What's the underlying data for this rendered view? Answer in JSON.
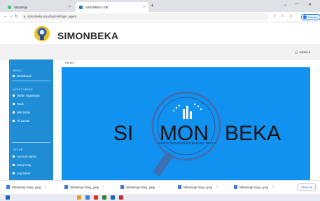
{
  "browser": {
    "tabs": [
      {
        "label": "WhatsApp",
        "active": false
      },
      {
        "label": "SIMONBEKA SIB",
        "active": true
      }
    ],
    "new_tab": "+",
    "window_controls": {
      "minimize": "⌄",
      "restore": "—",
      "close": "✕"
    },
    "url": "simonbeka.my.id/admin/login_agent",
    "profile_label": "Paused"
  },
  "app": {
    "brand": "SIMONBEKA",
    "user_menu": "Admin"
  },
  "sidebar": {
    "menu_title": "MENU",
    "menu_items": [
      {
        "label": "Dashboard"
      }
    ],
    "monitoring_title": "MONITORING",
    "monitoring_items": [
      {
        "label": "Daftar Organisasi"
      },
      {
        "label": "Topik"
      },
      {
        "label": "Hilir Sabar"
      },
      {
        "label": "Tif Laman"
      }
    ],
    "setup_title": "SETUP",
    "setup_items": [
      {
        "label": "Account Admin"
      },
      {
        "label": "Setup Anty"
      },
      {
        "label": "Log Saber"
      }
    ]
  },
  "breadcrumb": "Home /",
  "hero": {
    "title_left": "SI",
    "title_mid": "MON",
    "title_right": "BEKA",
    "subtitle": "SISTEM MONITORING BARANG BEKAS",
    "accent": "#1192f0",
    "ring_color": "#3f6fb3"
  },
  "downloads": [
    {
      "name": "WhatsApp Imag...jpeg"
    },
    {
      "name": "WhatsApp Imag...jpeg"
    },
    {
      "name": "WhatsApp Imag...jpeg"
    },
    {
      "name": "WhatsApp Imag...jpeg"
    },
    {
      "name": "WhatsApp Imag...jpeg"
    }
  ],
  "show_all": "Show all"
}
